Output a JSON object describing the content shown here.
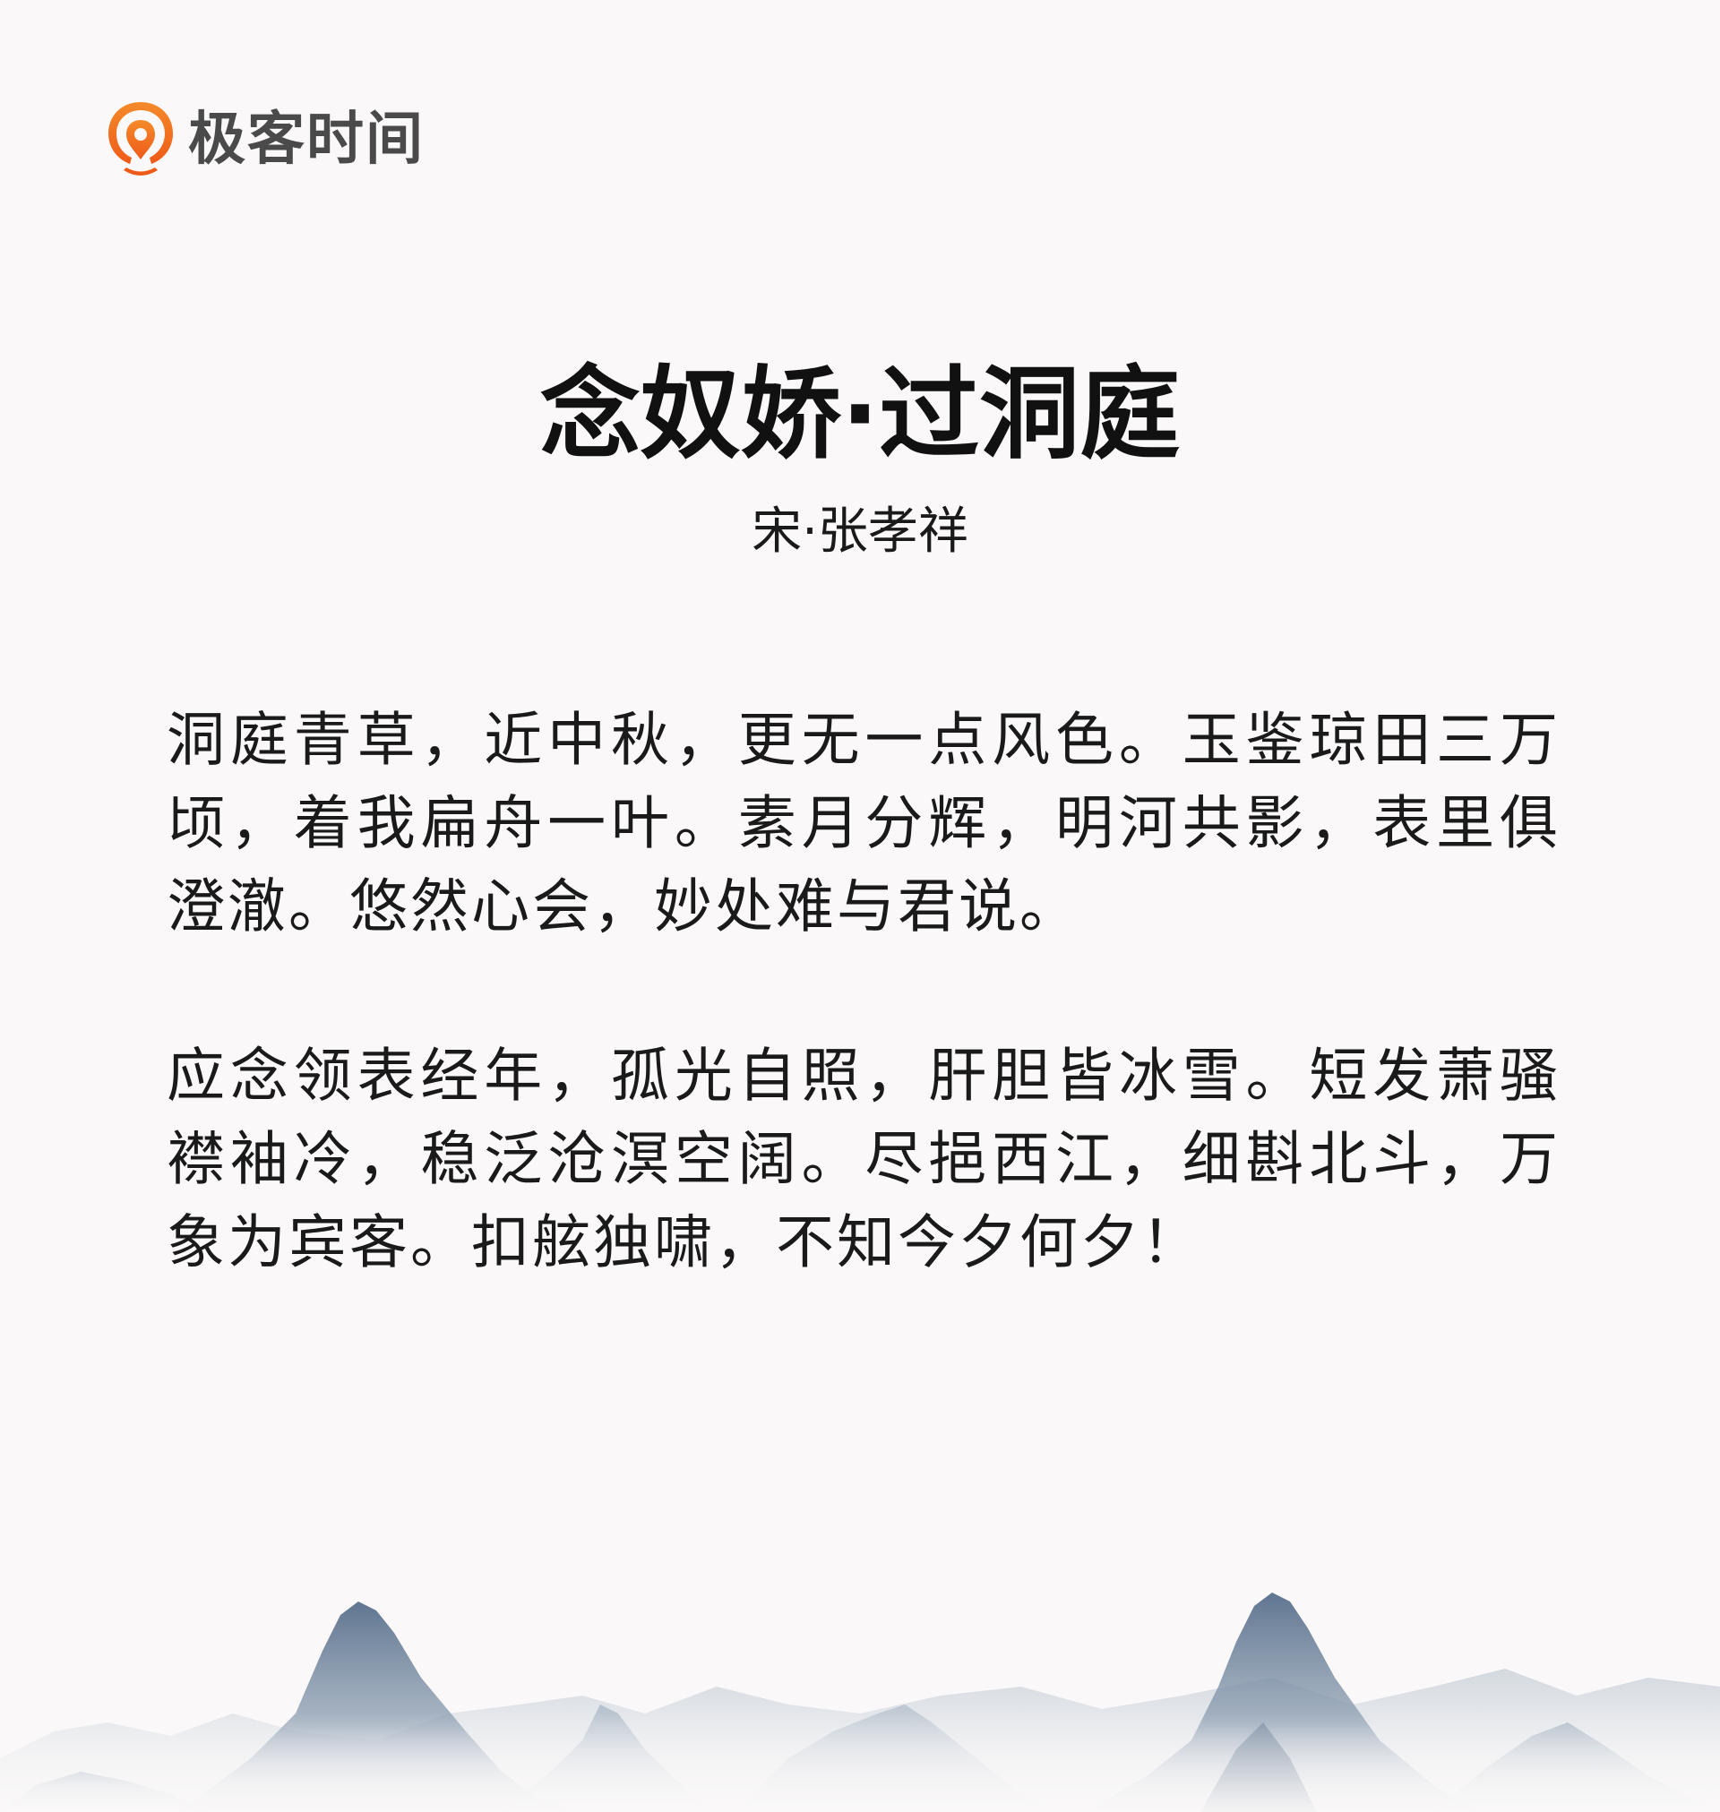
{
  "brand": {
    "name": "极客时间",
    "accent_color": "#f26b1d",
    "icon": "geektime-logo-icon"
  },
  "poem": {
    "title": "念奴娇·过洞庭",
    "author": "宋·张孝祥",
    "stanzas": [
      "洞庭青草，近中秋，更无一点风色。玉鉴琼田三万顷，着我扁舟一叶。素月分辉，明河共影，表里俱澄澈。悠然心会，妙处难与君说。",
      "应念领表经年，孤光自照，肝胆皆冰雪。短发萧骚襟袖冷，稳泛沧溟空阔。尽挹西江，细斟北斗，万象为宾客。扣舷独啸，不知今夕何夕！"
    ]
  },
  "decoration": {
    "icon": "ink-mountains-icon",
    "color": "#6f849c"
  }
}
